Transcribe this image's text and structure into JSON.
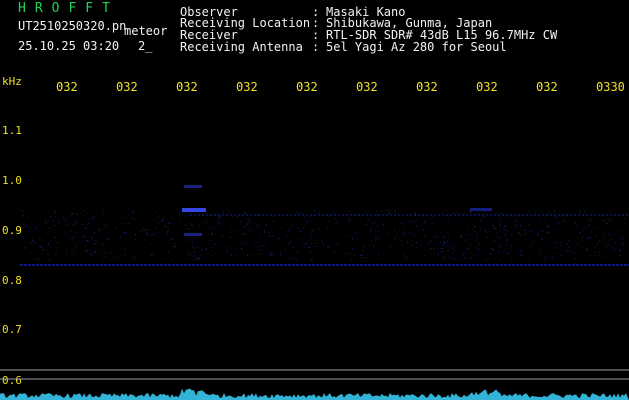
{
  "header": {
    "brand": "HROFFT",
    "filename": "UT2510250320.pn",
    "mode": "meteor",
    "datetime": "25.10.25 03:20",
    "count": "2",
    "count_mark": "_",
    "fields": [
      {
        "label": "Observer",
        "sep": ":",
        "value": "Masaki Kano"
      },
      {
        "label": "Receiving Location",
        "sep": ":",
        "value": "Shibukawa, Gunma, Japan"
      },
      {
        "label": "Receiver",
        "sep": ":",
        "value": "RTL-SDR SDR# 43dB L15 96.7MHz CW"
      },
      {
        "label": "Receiving Antenna",
        "sep": ":",
        "value": "5el Yagi Az 280 for Seoul"
      }
    ]
  },
  "axis": {
    "unit": "kHz",
    "time_ticks": [
      "032",
      "032",
      "032",
      "032",
      "032",
      "032",
      "032",
      "032",
      "032",
      "0330"
    ],
    "freq_ticks": [
      {
        "label": "1.1",
        "value": 1.1
      },
      {
        "label": "1.0",
        "value": 1.0
      },
      {
        "label": "0.9",
        "value": 0.9
      },
      {
        "label": "0.8",
        "value": 0.8
      },
      {
        "label": "0.7",
        "value": 0.7
      },
      {
        "label": "0.6",
        "value": 0.6
      }
    ]
  },
  "colors": {
    "background": "#000000",
    "header_text": "#f2f2f2",
    "tick_text": "#f0e020",
    "brand_text": "#1fd35a",
    "spectrum_trace": "#36c8f0",
    "signal": "#2a3cff"
  }
}
